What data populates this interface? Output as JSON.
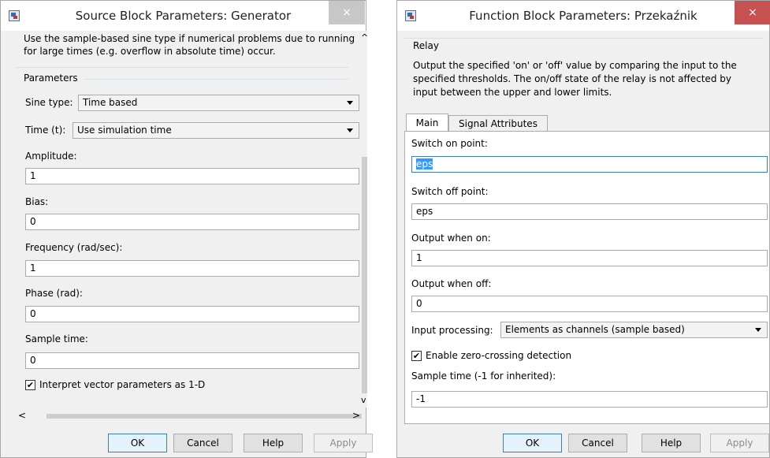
{
  "generator_dialog": {
    "title": "Source Block Parameters: Generator",
    "close_glyph": "×",
    "description_line1": "Use the sample-based sine type if numerical problems due to running",
    "description_line2": "for large times (e.g. overflow in absolute time) occur.",
    "parameters_group": "Parameters",
    "sine_type": {
      "label": "Sine type:",
      "value": "Time based"
    },
    "time": {
      "label": "Time (t):",
      "value": "Use simulation time"
    },
    "amplitude": {
      "label": "Amplitude:",
      "value": "1"
    },
    "bias": {
      "label": "Bias:",
      "value": "0"
    },
    "frequency": {
      "label": "Frequency (rad/sec):",
      "value": "1"
    },
    "phase": {
      "label": "Phase (rad):",
      "value": "0"
    },
    "sample_time": {
      "label": "Sample time:",
      "value": "0"
    },
    "interpret_vector": {
      "label": "Interpret vector parameters as 1-D",
      "checked": true,
      "check_glyph": "✔"
    },
    "scroll_up": "^",
    "scroll_down": "v",
    "scroll_left": "<",
    "scroll_right": ">",
    "buttons": {
      "ok": "OK",
      "cancel": "Cancel",
      "help": "Help",
      "apply": "Apply"
    }
  },
  "relay_dialog": {
    "title": "Function Block Parameters: Przekaźnik",
    "close_glyph": "×",
    "block_name": "Relay",
    "description_line1": "Output the specified 'on' or 'off' value by comparing the input to the",
    "description_line2": "specified thresholds.  The on/off state of the relay is not affected by",
    "description_line3": "input between the upper and lower limits.",
    "tabs": [
      "Main",
      "Signal Attributes"
    ],
    "switch_on": {
      "label": "Switch on point:",
      "value": "eps"
    },
    "switch_off": {
      "label": "Switch off point:",
      "value": "eps"
    },
    "output_on": {
      "label": "Output when on:",
      "value": "1"
    },
    "output_off": {
      "label": "Output when off:",
      "value": "0"
    },
    "input_processing": {
      "label": "Input processing:",
      "value": "Elements as channels (sample based)"
    },
    "zero_crossing": {
      "label": "Enable zero-crossing detection",
      "checked": true,
      "check_glyph": "✔"
    },
    "sample_time": {
      "label": "Sample time (-1 for inherited):",
      "value": "-1"
    },
    "buttons": {
      "ok": "OK",
      "cancel": "Cancel",
      "help": "Help",
      "apply": "Apply"
    }
  }
}
